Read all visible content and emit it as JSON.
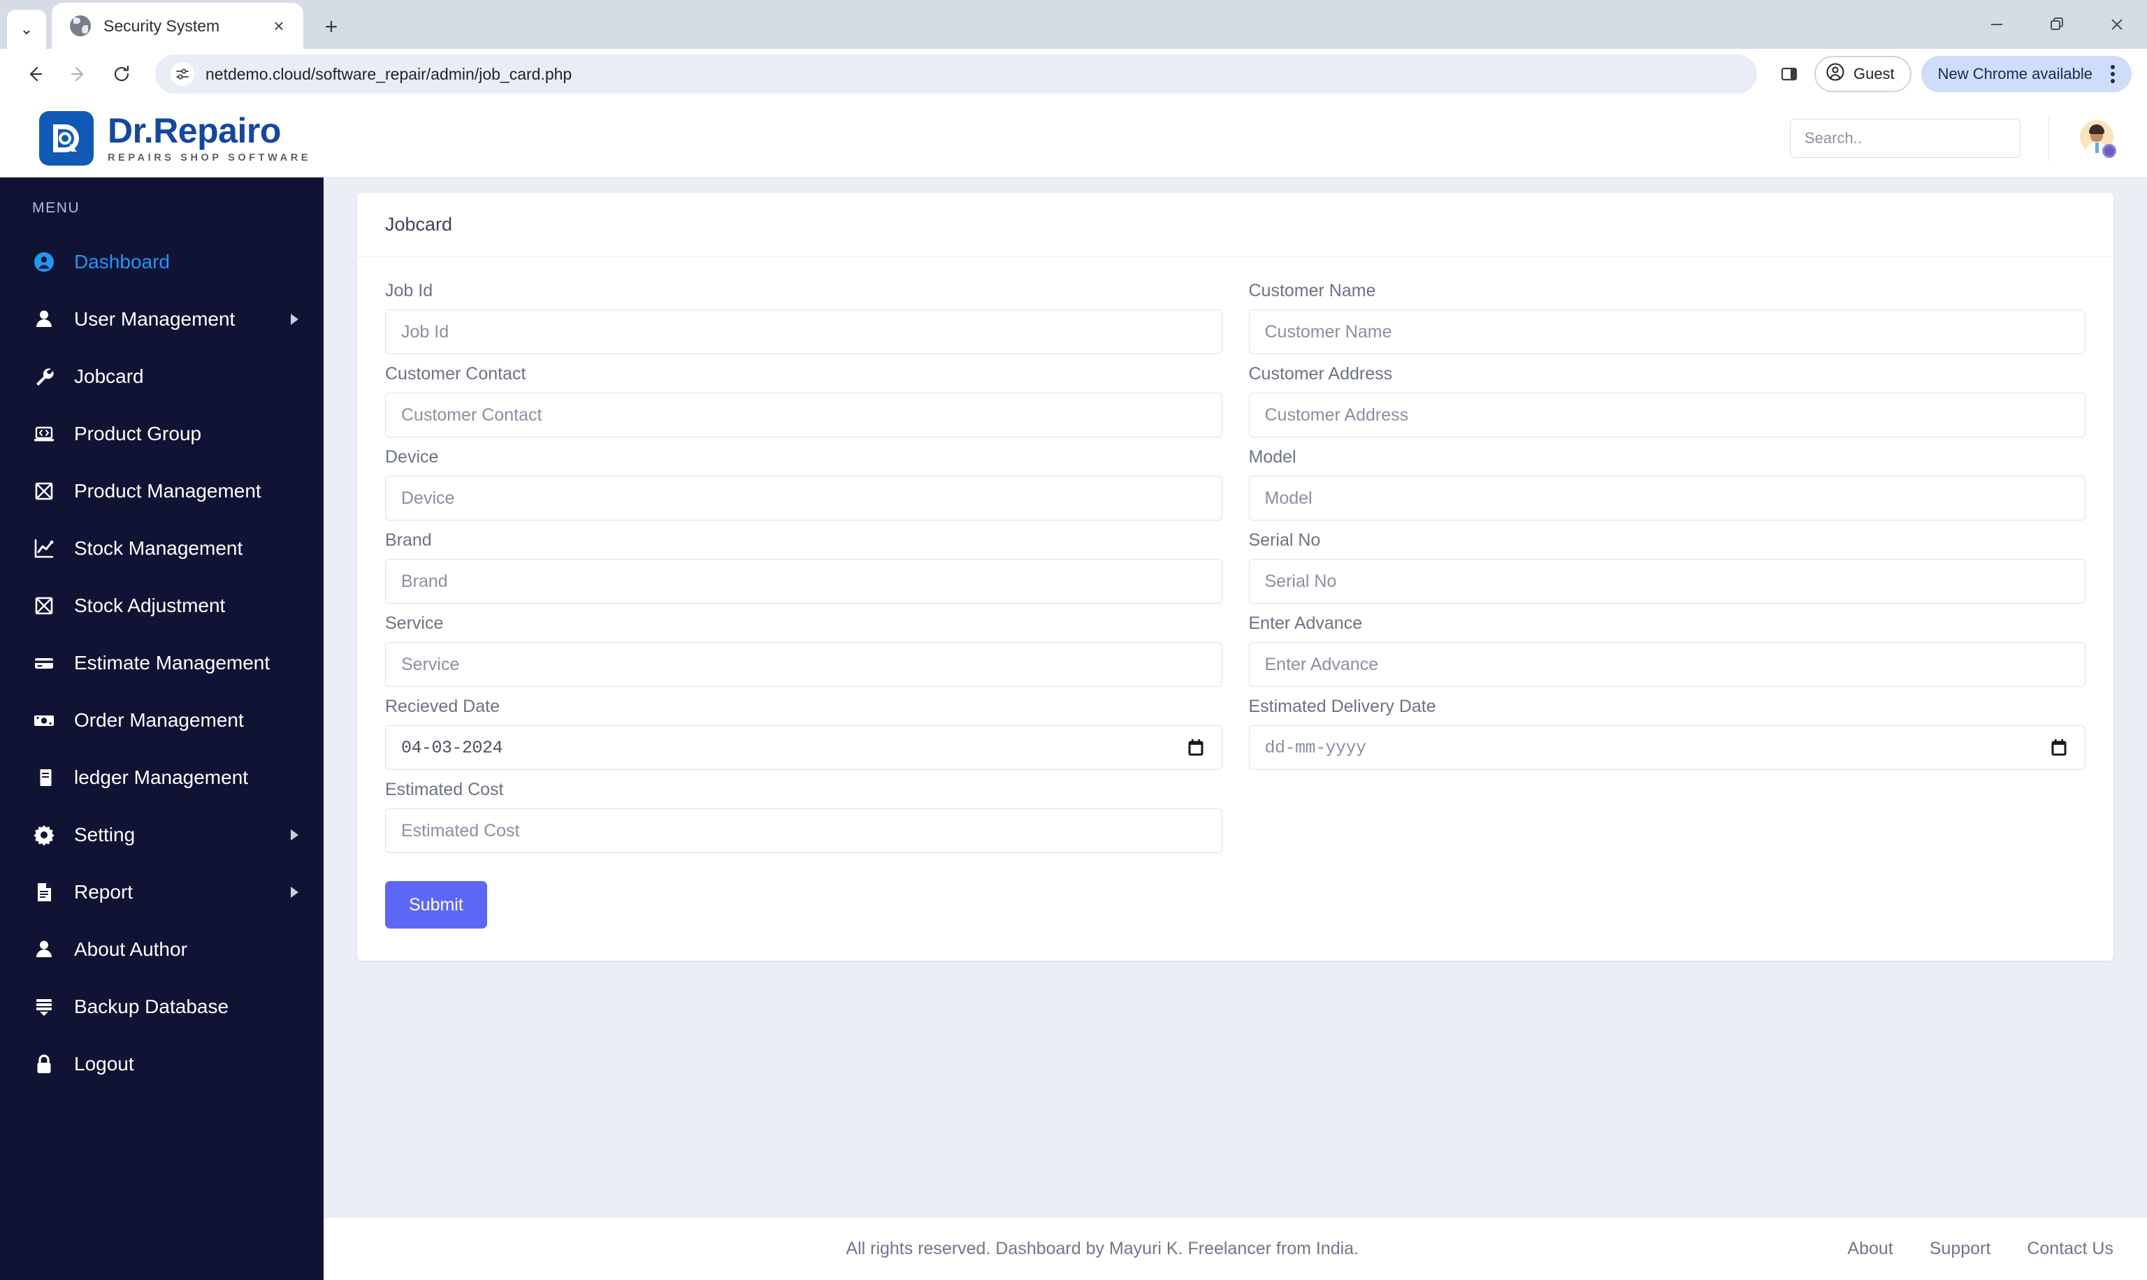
{
  "browser": {
    "tab": {
      "title": "Security System",
      "favicon": "globe-icon",
      "close": "×"
    },
    "new_tab_label": "+",
    "tab_search_chevron": "⌄",
    "window_controls": {
      "minimize": "—",
      "maximize": "❐",
      "close": "✕"
    },
    "nav": {
      "back": "←",
      "forward": "→",
      "reload": "⟳"
    },
    "url": "netdemo.cloud/software_repair/admin/job_card.php",
    "site_info_icon": "tune-icon",
    "side_panel_icon": "side-panel-icon",
    "guest_label": "Guest",
    "update_pill_label": "New Chrome available",
    "menu_icon": "kebab-menu-icon"
  },
  "app": {
    "brand": {
      "name": "Dr.Repairo",
      "tagline": "REPAIRS SHOP SOFTWARE"
    },
    "search": {
      "placeholder": "Search..",
      "value": ""
    },
    "avatar_name": "user-avatar"
  },
  "sidebar": {
    "heading": "MENU",
    "items": [
      {
        "label": "Dashboard",
        "icon": "user-circle-icon",
        "active": true,
        "has_arrow": false
      },
      {
        "label": "User Management",
        "icon": "user-icon",
        "active": false,
        "has_arrow": true
      },
      {
        "label": "Jobcard",
        "icon": "wrench-icon",
        "active": false,
        "has_arrow": false
      },
      {
        "label": "Product Group",
        "icon": "laptop-code-icon",
        "active": false,
        "has_arrow": false
      },
      {
        "label": "Product Management",
        "icon": "box-icon",
        "active": false,
        "has_arrow": false
      },
      {
        "label": "Stock Management",
        "icon": "chart-line-icon",
        "active": false,
        "has_arrow": false
      },
      {
        "label": "Stock Adjustment",
        "icon": "box-icon",
        "active": false,
        "has_arrow": false
      },
      {
        "label": "Estimate Management",
        "icon": "card-icon",
        "active": false,
        "has_arrow": false
      },
      {
        "label": "Order Management",
        "icon": "money-bill-icon",
        "active": false,
        "has_arrow": false
      },
      {
        "label": "ledger Management",
        "icon": "book-icon",
        "active": false,
        "has_arrow": false
      },
      {
        "label": "Setting",
        "icon": "gear-icon",
        "active": false,
        "has_arrow": true
      },
      {
        "label": "Report",
        "icon": "file-text-icon",
        "active": false,
        "has_arrow": true
      },
      {
        "label": "About Author",
        "icon": "user-icon",
        "active": false,
        "has_arrow": false
      },
      {
        "label": "Backup Database",
        "icon": "database-icon",
        "active": false,
        "has_arrow": false
      },
      {
        "label": "Logout",
        "icon": "lock-icon",
        "active": false,
        "has_arrow": false
      }
    ]
  },
  "main": {
    "card_title": "Jobcard",
    "fields": [
      {
        "label": "Job Id",
        "placeholder": "Job Id",
        "value": "",
        "type": "text"
      },
      {
        "label": "Customer Name",
        "placeholder": "Customer Name",
        "value": "",
        "type": "text"
      },
      {
        "label": "Customer Contact",
        "placeholder": "Customer Contact",
        "value": "",
        "type": "text"
      },
      {
        "label": "Customer Address",
        "placeholder": "Customer Address",
        "value": "",
        "type": "text"
      },
      {
        "label": "Device",
        "placeholder": "Device",
        "value": "",
        "type": "text"
      },
      {
        "label": "Model",
        "placeholder": "Model",
        "value": "",
        "type": "text"
      },
      {
        "label": "Brand",
        "placeholder": "Brand",
        "value": "",
        "type": "text"
      },
      {
        "label": "Serial No",
        "placeholder": "Serial No",
        "value": "",
        "type": "text"
      },
      {
        "label": "Service",
        "placeholder": "Service",
        "value": "",
        "type": "text"
      },
      {
        "label": "Enter Advance",
        "placeholder": "Enter Advance",
        "value": "",
        "type": "text"
      },
      {
        "label": "Recieved Date",
        "placeholder": "dd-mm-yyyy",
        "value": "04-03-2024",
        "type": "date"
      },
      {
        "label": "Estimated Delivery Date",
        "placeholder": "dd-mm-yyyy",
        "value": "",
        "type": "date"
      },
      {
        "label": "Estimated Cost",
        "placeholder": "Estimated Cost",
        "value": "",
        "type": "text"
      }
    ],
    "submit_label": "Submit"
  },
  "footer": {
    "text": "All rights reserved. Dashboard by Mayuri K. Freelancer from India.",
    "links": [
      "About",
      "Support",
      "Contact Us"
    ]
  },
  "colors": {
    "sidebar_bg": "#111334",
    "accent_active": "#2196f3",
    "brand_blue": "#13489e",
    "submit_purple": "#5d67f5",
    "page_bg": "#eceef5"
  }
}
